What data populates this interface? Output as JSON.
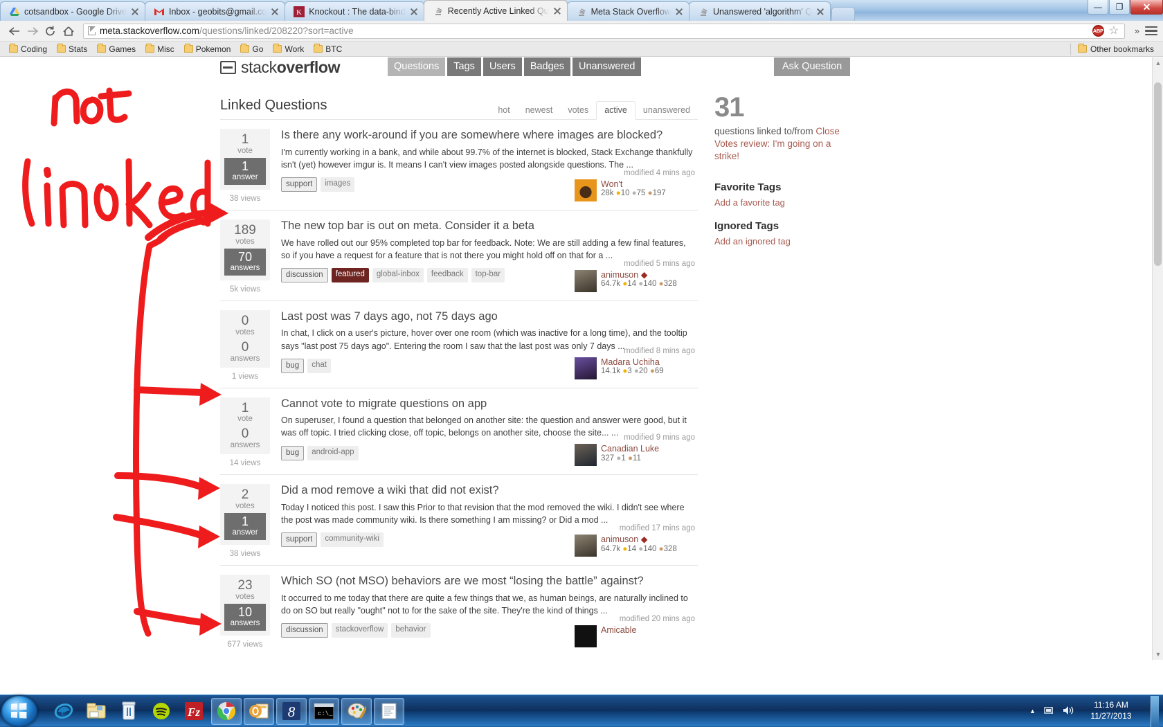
{
  "browser": {
    "tabs": [
      {
        "title": "cotsandbox - Google Drive",
        "favicon": "google-drive-icon",
        "active": false
      },
      {
        "title": "Inbox - geobits@gmail.co",
        "favicon": "gmail-icon",
        "active": false
      },
      {
        "title": "Knockout : The data-bind",
        "favicon": "knockout-icon",
        "active": false
      },
      {
        "title": "Recently Active Linked Qu",
        "favicon": "stackoverflow-icon",
        "active": true
      },
      {
        "title": "Meta Stack Overflow",
        "favicon": "stackoverflow-icon",
        "active": false
      },
      {
        "title": "Unanswered 'algorithm' Q",
        "favicon": "stackoverflow-icon",
        "active": false
      }
    ],
    "url_host": "meta.stackoverflow.com",
    "url_rest": "/questions/linked/208220?sort=active",
    "adblock_label": "ABP",
    "window_controls": {
      "minimize": "—",
      "maximize": "❐",
      "close": "✕"
    },
    "bookmarks": [
      "Coding",
      "Stats",
      "Games",
      "Misc",
      "Pokemon",
      "Go",
      "Work",
      "BTC"
    ],
    "other_bookmarks": "Other bookmarks"
  },
  "site": {
    "logo_light": "stack",
    "logo_bold": "overflow",
    "nav": [
      {
        "label": "Questions",
        "selected": true
      },
      {
        "label": "Tags",
        "selected": false
      },
      {
        "label": "Users",
        "selected": false
      },
      {
        "label": "Badges",
        "selected": false
      },
      {
        "label": "Unanswered",
        "selected": false
      }
    ],
    "ask_button": "Ask Question"
  },
  "main": {
    "page_title": "Linked Questions",
    "sort_tabs": [
      {
        "label": "hot",
        "selected": false
      },
      {
        "label": "newest",
        "selected": false
      },
      {
        "label": "votes",
        "selected": false
      },
      {
        "label": "active",
        "selected": true
      },
      {
        "label": "unanswered",
        "selected": false
      }
    ],
    "questions": [
      {
        "votes": "1",
        "votes_label": "vote",
        "answers": "1",
        "answers_label": "answer",
        "answers_accepted": true,
        "views": "38 views",
        "title": "Is there any work-around if you are somewhere where images are blocked?",
        "excerpt": "I'm currently working in a bank, and while about 99.7% of the internet is blocked, Stack Exchange thankfully isn't (yet) however imgur is. It means I can't view images posted alongside questions. The ...",
        "tags": [
          {
            "label": "support",
            "style": "strong"
          },
          {
            "label": "images",
            "style": "plain"
          }
        ],
        "modified": "modified 4 mins ago",
        "user": "Won't",
        "user_diamond": false,
        "rep": "28k",
        "gold": "10",
        "silver": "75",
        "bronze": "197",
        "avatar_color": "#d8822a"
      },
      {
        "votes": "189",
        "votes_label": "votes",
        "answers": "70",
        "answers_label": "answers",
        "answers_accepted": true,
        "views": "5k views",
        "title": "The new top bar is out on meta. Consider it a beta",
        "excerpt": "We have rolled out our 95% completed top bar for feedback. Note: We are still adding a few final features, so if you have a request for a feature that is not there you might hold off on that for a ...",
        "tags": [
          {
            "label": "discussion",
            "style": "strong"
          },
          {
            "label": "featured",
            "style": "featured"
          },
          {
            "label": "global-inbox",
            "style": "plain"
          },
          {
            "label": "feedback",
            "style": "plain"
          },
          {
            "label": "top-bar",
            "style": "plain"
          }
        ],
        "modified": "modified 5 mins ago",
        "user": "animuson",
        "user_diamond": true,
        "rep": "64.7k",
        "gold": "14",
        "silver": "140",
        "bronze": "328",
        "avatar_color": "#6b6257"
      },
      {
        "votes": "0",
        "votes_label": "votes",
        "answers": "0",
        "answers_label": "answers",
        "answers_accepted": false,
        "views": "1 views",
        "title": "Last post was 7 days ago, not 75 days ago",
        "excerpt": "In chat, I click on a user's picture, hover over one room (which was inactive for a long time), and the tooltip says \"last post 75 days ago\". Entering the room I saw that the last post was only 7 days ...",
        "tags": [
          {
            "label": "bug",
            "style": "strong"
          },
          {
            "label": "chat",
            "style": "plain"
          }
        ],
        "modified": "modified 8 mins ago",
        "user": "Madara Uchiha",
        "user_diamond": false,
        "rep": "14.1k",
        "gold": "3",
        "silver": "20",
        "bronze": "69",
        "avatar_color": "#4d3a6b"
      },
      {
        "votes": "1",
        "votes_label": "vote",
        "answers": "0",
        "answers_label": "answers",
        "answers_accepted": false,
        "views": "14 views",
        "title": "Cannot vote to migrate questions on app",
        "excerpt": "On superuser, I found a question that belonged on another site: the question and answer were good, but it was off topic. I tried clicking close, off topic, belongs on another site, choose the site... ...",
        "tags": [
          {
            "label": "bug",
            "style": "strong"
          },
          {
            "label": "android-app",
            "style": "plain"
          }
        ],
        "modified": "modified 9 mins ago",
        "user": "Canadian Luke",
        "user_diamond": false,
        "rep": "327",
        "gold": "",
        "silver": "1",
        "bronze": "11",
        "avatar_color": "#3e4a55"
      },
      {
        "votes": "2",
        "votes_label": "votes",
        "answers": "1",
        "answers_label": "answer",
        "answers_accepted": true,
        "views": "38 views",
        "title": "Did a mod remove a wiki that did not exist?",
        "excerpt": "Today I noticed this post. I saw this Prior to that revision that the mod removed the wiki. I didn't see where the post was made community wiki. Is there something I am missing? or Did a mod ...",
        "tags": [
          {
            "label": "support",
            "style": "strong"
          },
          {
            "label": "community-wiki",
            "style": "plain"
          }
        ],
        "modified": "modified 17 mins ago",
        "user": "animuson",
        "user_diamond": true,
        "rep": "64.7k",
        "gold": "14",
        "silver": "140",
        "bronze": "328",
        "avatar_color": "#6b6257"
      },
      {
        "votes": "23",
        "votes_label": "votes",
        "answers": "10",
        "answers_label": "answers",
        "answers_accepted": true,
        "views": "677 views",
        "title": "Which SO (not MSO) behaviors are we most “losing the battle” against?",
        "excerpt": "It occurred to me today that there are quite a few things that we, as human beings, are naturally inclined to do on SO but really \"ought\" not to for the sake of the site. They're the kind of things ...",
        "tags": [
          {
            "label": "discussion",
            "style": "strong"
          },
          {
            "label": "stackoverflow",
            "style": "plain"
          },
          {
            "label": "behavior",
            "style": "plain"
          }
        ],
        "modified": "modified 20 mins ago",
        "user": "Amicable",
        "user_diamond": false,
        "rep": "",
        "gold": "",
        "silver": "",
        "bronze": "",
        "avatar_color": "#1b1b1b"
      }
    ]
  },
  "sidebar": {
    "linked_count": "31",
    "linked_text_prefix": "questions linked to/from ",
    "linked_link": "Close Votes review: I'm going on a strike!",
    "favorite_tags_heading": "Favorite Tags",
    "add_favorite_tag": "Add a favorite tag",
    "ignored_tags_heading": "Ignored Tags",
    "add_ignored_tag": "Add an ignored tag"
  },
  "annotation": {
    "word_one": "not",
    "word_two": "linked",
    "ink_color": "#ee1c1c"
  },
  "taskbar": {
    "items": [
      "internet-explorer-icon",
      "file-explorer-icon",
      "recycle-bin-icon",
      "spotify-icon",
      "filezilla-icon",
      "chrome-icon",
      "outlook-icon",
      "eight-app-icon",
      "command-prompt-icon",
      "paint-icon",
      "notepad-icon"
    ],
    "time": "11:16 AM",
    "date": "11/27/2013"
  }
}
